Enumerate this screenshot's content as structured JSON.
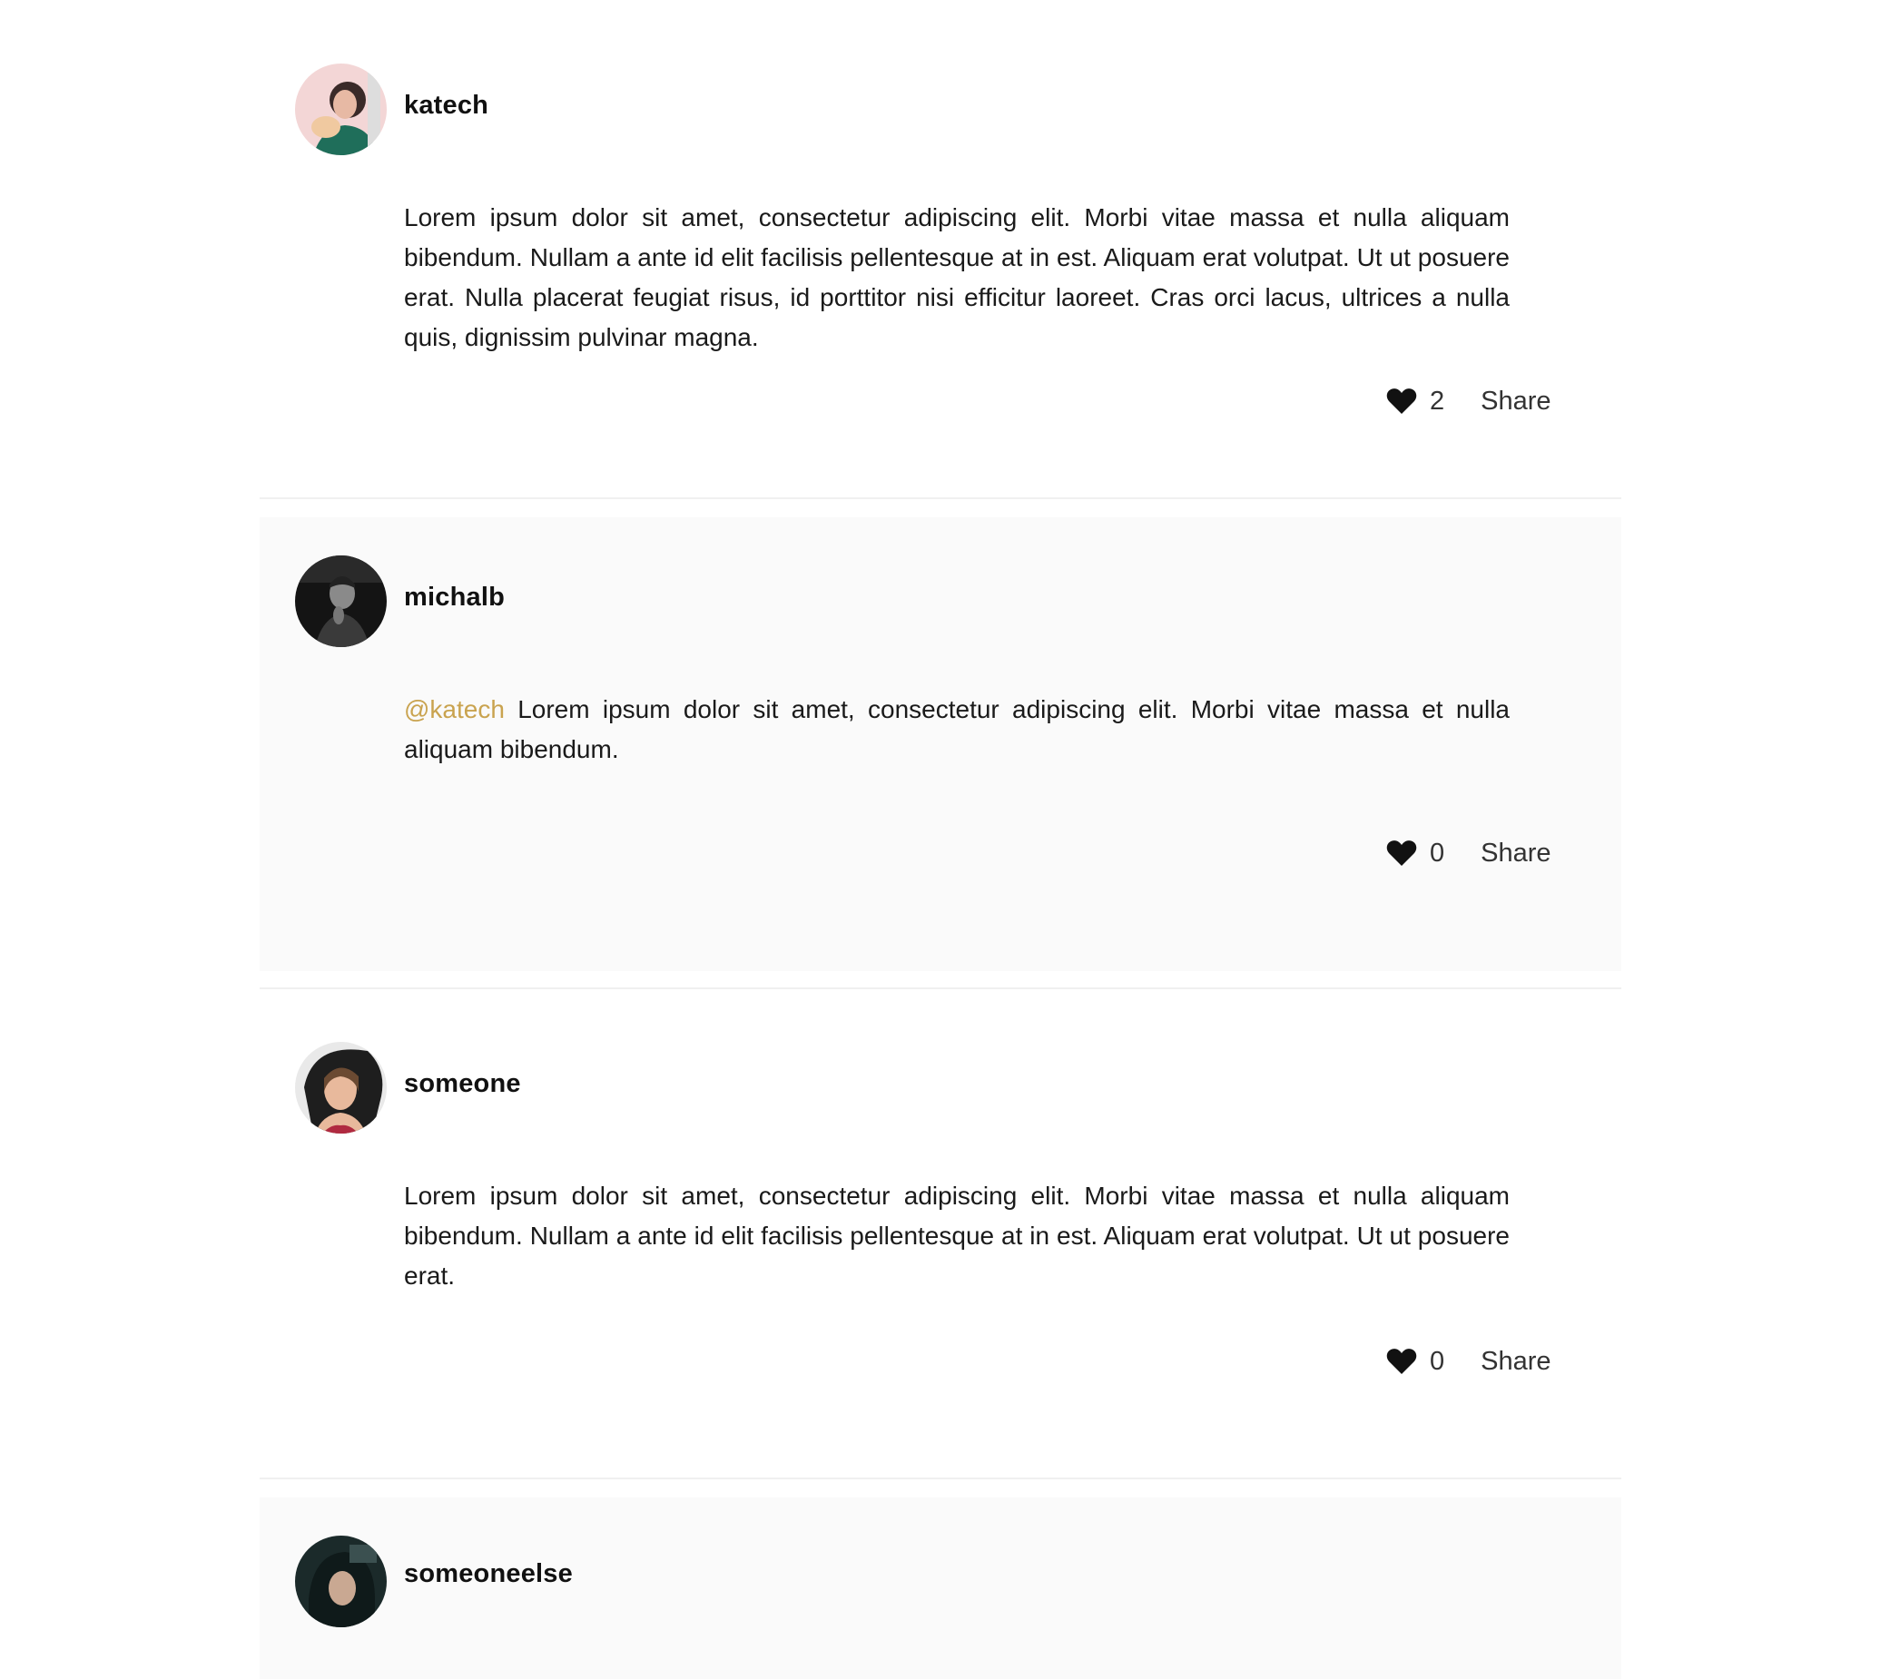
{
  "posts": [
    {
      "username": "katech",
      "mention": "",
      "text": "Lorem ipsum dolor sit amet, consectetur adipiscing elit. Morbi vitae massa et nulla aliquam bibendum. Nullam a ante id elit facilisis pellentesque at in est. Aliquam erat volutpat. Ut ut posuere erat. Nulla placerat feugiat risus, id porttitor nisi efficitur laoreet. Cras orci lacus, ultrices a nulla quis, dignissim pulvinar magna.",
      "likes": "2",
      "share_label": "Share",
      "avatar_icon": "avatar-photo-icon"
    },
    {
      "username": "michalb",
      "mention": "@katech",
      "text": " Lorem ipsum dolor sit amet, consectetur adipiscing elit. Morbi vitae massa et nulla aliquam bibendum.",
      "likes": "0",
      "share_label": "Share",
      "avatar_icon": "avatar-photo-icon"
    },
    {
      "username": "someone",
      "mention": "",
      "text": "Lorem ipsum dolor sit amet, consectetur adipiscing elit. Morbi vitae massa et nulla aliquam bibendum. Nullam a ante id elit facilisis pellentesque at in est. Aliquam erat volutpat. Ut ut posuere erat.",
      "likes": "0",
      "share_label": "Share",
      "avatar_icon": "avatar-photo-icon"
    },
    {
      "username": "someoneelse",
      "mention": "",
      "text": "",
      "likes": "",
      "share_label": "",
      "avatar_icon": "avatar-photo-icon"
    }
  ],
  "colors": {
    "mention": "#c9a34f",
    "shaded_row": "#fafafa",
    "divider": "#f0f0f0"
  },
  "icons": {
    "like": "heart-icon"
  }
}
